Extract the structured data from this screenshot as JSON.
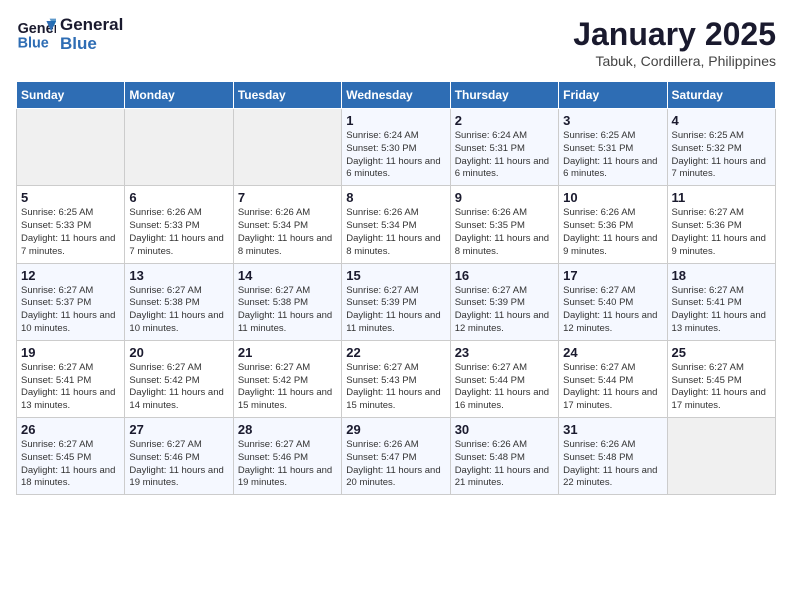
{
  "logo": {
    "line1": "General",
    "line2": "Blue"
  },
  "title": "January 2025",
  "subtitle": "Tabuk, Cordillera, Philippines",
  "days_of_week": [
    "Sunday",
    "Monday",
    "Tuesday",
    "Wednesday",
    "Thursday",
    "Friday",
    "Saturday"
  ],
  "weeks": [
    [
      {
        "day": "",
        "info": ""
      },
      {
        "day": "",
        "info": ""
      },
      {
        "day": "",
        "info": ""
      },
      {
        "day": "1",
        "info": "Sunrise: 6:24 AM\nSunset: 5:30 PM\nDaylight: 11 hours and 6 minutes."
      },
      {
        "day": "2",
        "info": "Sunrise: 6:24 AM\nSunset: 5:31 PM\nDaylight: 11 hours and 6 minutes."
      },
      {
        "day": "3",
        "info": "Sunrise: 6:25 AM\nSunset: 5:31 PM\nDaylight: 11 hours and 6 minutes."
      },
      {
        "day": "4",
        "info": "Sunrise: 6:25 AM\nSunset: 5:32 PM\nDaylight: 11 hours and 7 minutes."
      }
    ],
    [
      {
        "day": "5",
        "info": "Sunrise: 6:25 AM\nSunset: 5:33 PM\nDaylight: 11 hours and 7 minutes."
      },
      {
        "day": "6",
        "info": "Sunrise: 6:26 AM\nSunset: 5:33 PM\nDaylight: 11 hours and 7 minutes."
      },
      {
        "day": "7",
        "info": "Sunrise: 6:26 AM\nSunset: 5:34 PM\nDaylight: 11 hours and 8 minutes."
      },
      {
        "day": "8",
        "info": "Sunrise: 6:26 AM\nSunset: 5:34 PM\nDaylight: 11 hours and 8 minutes."
      },
      {
        "day": "9",
        "info": "Sunrise: 6:26 AM\nSunset: 5:35 PM\nDaylight: 11 hours and 8 minutes."
      },
      {
        "day": "10",
        "info": "Sunrise: 6:26 AM\nSunset: 5:36 PM\nDaylight: 11 hours and 9 minutes."
      },
      {
        "day": "11",
        "info": "Sunrise: 6:27 AM\nSunset: 5:36 PM\nDaylight: 11 hours and 9 minutes."
      }
    ],
    [
      {
        "day": "12",
        "info": "Sunrise: 6:27 AM\nSunset: 5:37 PM\nDaylight: 11 hours and 10 minutes."
      },
      {
        "day": "13",
        "info": "Sunrise: 6:27 AM\nSunset: 5:38 PM\nDaylight: 11 hours and 10 minutes."
      },
      {
        "day": "14",
        "info": "Sunrise: 6:27 AM\nSunset: 5:38 PM\nDaylight: 11 hours and 11 minutes."
      },
      {
        "day": "15",
        "info": "Sunrise: 6:27 AM\nSunset: 5:39 PM\nDaylight: 11 hours and 11 minutes."
      },
      {
        "day": "16",
        "info": "Sunrise: 6:27 AM\nSunset: 5:39 PM\nDaylight: 11 hours and 12 minutes."
      },
      {
        "day": "17",
        "info": "Sunrise: 6:27 AM\nSunset: 5:40 PM\nDaylight: 11 hours and 12 minutes."
      },
      {
        "day": "18",
        "info": "Sunrise: 6:27 AM\nSunset: 5:41 PM\nDaylight: 11 hours and 13 minutes."
      }
    ],
    [
      {
        "day": "19",
        "info": "Sunrise: 6:27 AM\nSunset: 5:41 PM\nDaylight: 11 hours and 13 minutes."
      },
      {
        "day": "20",
        "info": "Sunrise: 6:27 AM\nSunset: 5:42 PM\nDaylight: 11 hours and 14 minutes."
      },
      {
        "day": "21",
        "info": "Sunrise: 6:27 AM\nSunset: 5:42 PM\nDaylight: 11 hours and 15 minutes."
      },
      {
        "day": "22",
        "info": "Sunrise: 6:27 AM\nSunset: 5:43 PM\nDaylight: 11 hours and 15 minutes."
      },
      {
        "day": "23",
        "info": "Sunrise: 6:27 AM\nSunset: 5:44 PM\nDaylight: 11 hours and 16 minutes."
      },
      {
        "day": "24",
        "info": "Sunrise: 6:27 AM\nSunset: 5:44 PM\nDaylight: 11 hours and 17 minutes."
      },
      {
        "day": "25",
        "info": "Sunrise: 6:27 AM\nSunset: 5:45 PM\nDaylight: 11 hours and 17 minutes."
      }
    ],
    [
      {
        "day": "26",
        "info": "Sunrise: 6:27 AM\nSunset: 5:45 PM\nDaylight: 11 hours and 18 minutes."
      },
      {
        "day": "27",
        "info": "Sunrise: 6:27 AM\nSunset: 5:46 PM\nDaylight: 11 hours and 19 minutes."
      },
      {
        "day": "28",
        "info": "Sunrise: 6:27 AM\nSunset: 5:46 PM\nDaylight: 11 hours and 19 minutes."
      },
      {
        "day": "29",
        "info": "Sunrise: 6:26 AM\nSunset: 5:47 PM\nDaylight: 11 hours and 20 minutes."
      },
      {
        "day": "30",
        "info": "Sunrise: 6:26 AM\nSunset: 5:48 PM\nDaylight: 11 hours and 21 minutes."
      },
      {
        "day": "31",
        "info": "Sunrise: 6:26 AM\nSunset: 5:48 PM\nDaylight: 11 hours and 22 minutes."
      },
      {
        "day": "",
        "info": ""
      }
    ]
  ]
}
